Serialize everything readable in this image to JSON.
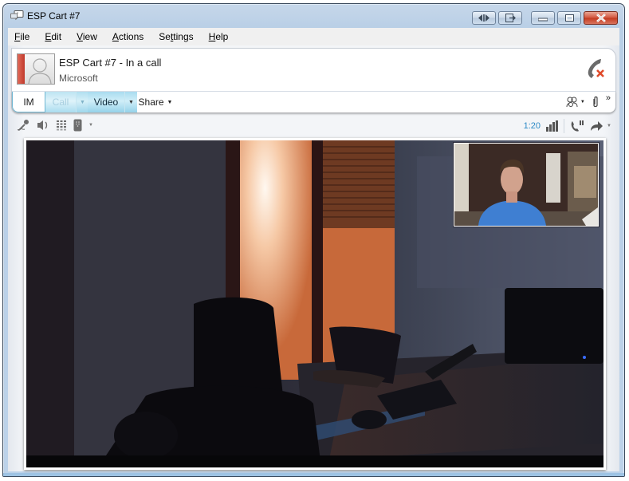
{
  "window": {
    "title": "ESP Cart #7",
    "icon": "chat-bubble-icon",
    "caption_buttons": [
      "compact-view",
      "pop-out",
      "minimize",
      "maximize",
      "close"
    ]
  },
  "menu": [
    {
      "label": "File",
      "accel": "F"
    },
    {
      "label": "Edit",
      "accel": "E"
    },
    {
      "label": "View",
      "accel": "V"
    },
    {
      "label": "Actions",
      "accel": "A"
    },
    {
      "label": "Settings",
      "accel": "t"
    },
    {
      "label": "Help",
      "accel": "H"
    }
  ],
  "contact": {
    "name_status": "ESP Cart #7 - In a call",
    "company": "Microsoft",
    "presence_color": "#c0392b"
  },
  "tabs": {
    "im": "IM",
    "call": "Call",
    "video": "Video",
    "share": "Share"
  },
  "toolbar_right": {
    "participants_icon": "people-icon",
    "attach_icon": "paperclip-icon",
    "overflow": "»"
  },
  "call_controls": {
    "left_icons": [
      "microphone-icon",
      "speaker-icon",
      "dialpad-icon",
      "device-icon"
    ],
    "timer": "1:20",
    "right_icons": [
      "signal-quality-icon",
      "hold-call-icon",
      "transfer-icon"
    ]
  },
  "video": {
    "main_feed": "Remote video: dark conference room with chairs, desk, keyboard and orange lit doorway",
    "self_view": "Local preview: man in blue t-shirt in home room"
  },
  "colors": {
    "accent_blue": "#2b8ac6",
    "tab_highlight": "#a9dcef",
    "hangup_red": "#e04a2a"
  }
}
